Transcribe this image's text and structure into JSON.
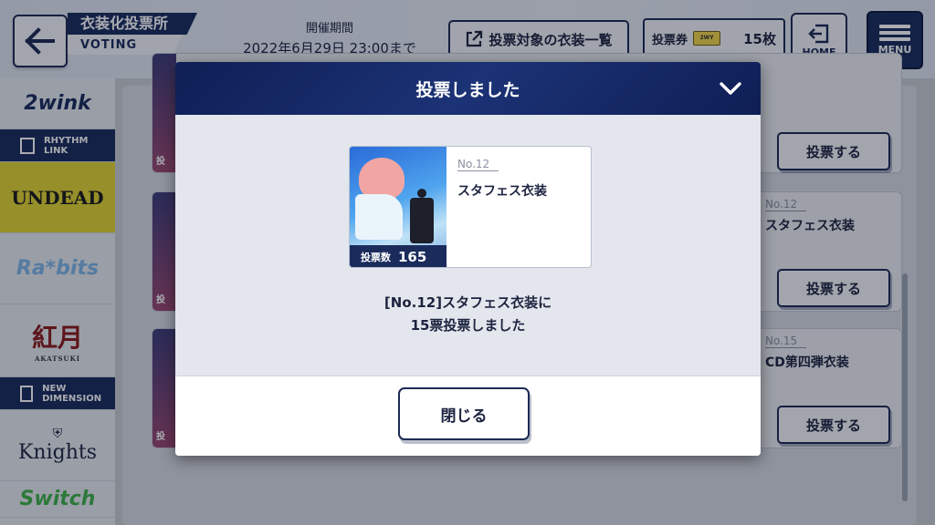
{
  "header": {
    "title_jp": "衣装化投票所",
    "title_en": "VOTING",
    "period_label": "開催期間",
    "period_value": "2022年6月29日 23:00まで",
    "costume_list_label": "投票対象の衣装一覧",
    "ticket_label": "投票券",
    "ticket_count": "15枚",
    "home_label": "HOME",
    "menu_label": "MENU"
  },
  "sidebar": {
    "items": [
      {
        "label": "2wink"
      },
      {
        "label": "RHYTHM LINK"
      },
      {
        "label": "UNDEAD"
      },
      {
        "label": "Ra*bits"
      },
      {
        "label": "紅月",
        "sub": "AKATSUKI"
      },
      {
        "label": "NEW DIMENSION"
      },
      {
        "label": "Knights"
      },
      {
        "label": "Switch"
      }
    ]
  },
  "background_list": {
    "cards": [
      {
        "no": "",
        "name": "",
        "vote_label": "投票する",
        "thumb_label": "投"
      },
      {
        "no": "No.12",
        "name": "スタフェス衣装",
        "vote_label": "投票する",
        "thumb_label": "投"
      },
      {
        "no": "No.15",
        "name": "CD第四弾衣装",
        "vote_label": "投票する",
        "thumb_label": "投"
      }
    ]
  },
  "modal": {
    "title": "投票しました",
    "card": {
      "no": "No.12",
      "name": "スタフェス衣装",
      "vote_count_label": "投票数",
      "vote_count": "165"
    },
    "message_line1": "[No.12]スタフェス衣装に",
    "message_line2": "15票投票しました",
    "close_label": "閉じる"
  },
  "colors": {
    "navy": "#1a2b5c",
    "modal_header": "#0f1f55",
    "undead_yellow": "#e4d530"
  }
}
